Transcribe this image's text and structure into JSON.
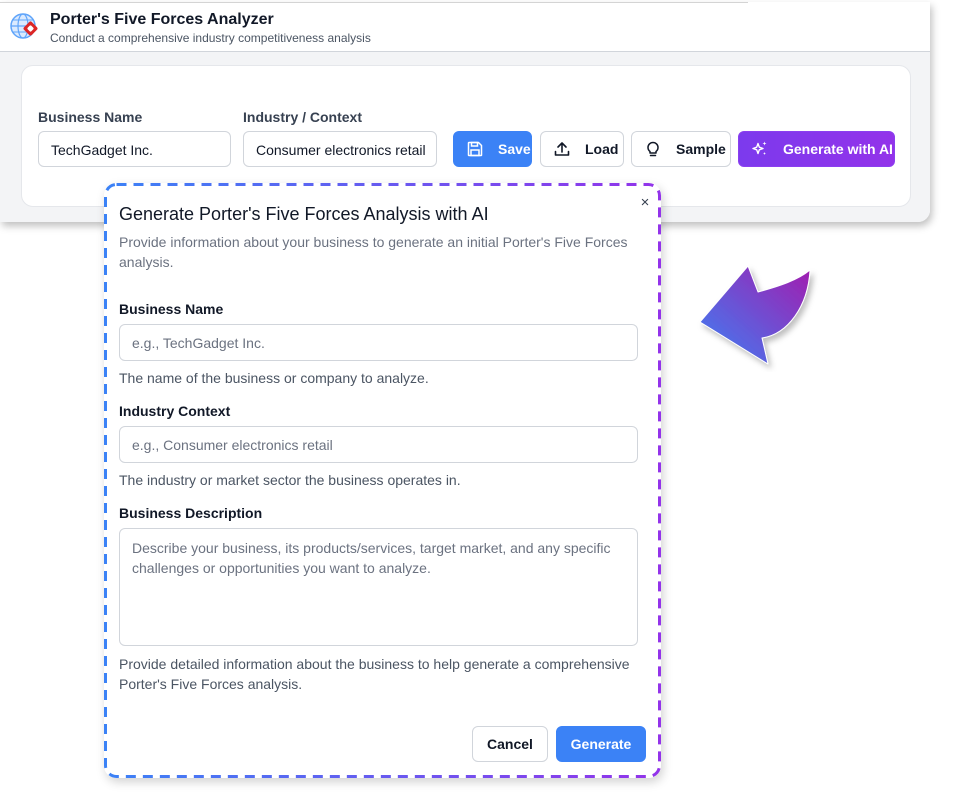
{
  "app": {
    "title": "Porter's Five Forces Analyzer",
    "subtitle": "Conduct a comprehensive industry competitiveness analysis",
    "logo_icon": "globe-logo-icon"
  },
  "form": {
    "business_name_label": "Business Name",
    "business_name_value": "TechGadget Inc.",
    "industry_label": "Industry / Context",
    "industry_value": "Consumer electronics retail"
  },
  "toolbar": {
    "save_label": "Save",
    "load_label": "Load",
    "sample_label": "Sample",
    "generate_ai_label": "Generate with AI"
  },
  "modal": {
    "close_glyph": "×",
    "title": "Generate Porter's Five Forces Analysis with AI",
    "description": "Provide information about your business to generate an initial Porter's Five Forces analysis.",
    "business_name": {
      "label": "Business Name",
      "placeholder": "e.g., TechGadget Inc.",
      "help": "The name of the business or company to analyze."
    },
    "industry": {
      "label": "Industry Context",
      "placeholder": "e.g., Consumer electronics retail",
      "help": "The industry or market sector the business operates in."
    },
    "description_field": {
      "label": "Business Description",
      "placeholder": "Describe your business, its products/services, target market, and any specific challenges or opportunities you want to analyze.",
      "help": "Provide detailed information about the business to help generate a comprehensive Porter's Five Forces analysis."
    },
    "cancel_label": "Cancel",
    "generate_label": "Generate"
  },
  "colors": {
    "primary": "#3b82f6",
    "ai_gradient_start": "#7c3aed",
    "ai_gradient_end": "#9333ea",
    "arrow_start": "#3b82f6",
    "arrow_end": "#a21caf"
  }
}
